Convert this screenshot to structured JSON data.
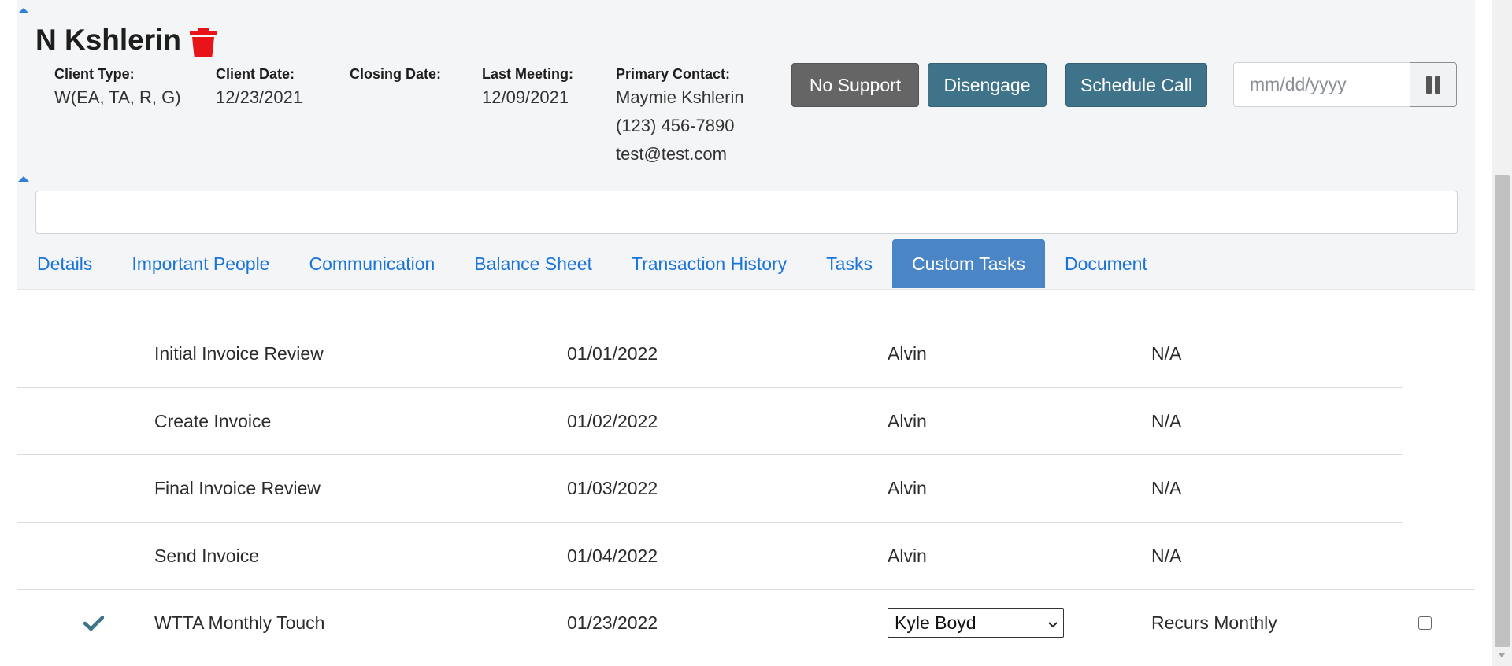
{
  "client": {
    "name": "N Kshlerin"
  },
  "fields": {
    "client_type": {
      "label": "Client Type:",
      "value": "W(EA, TA, R, G)"
    },
    "client_date": {
      "label": "Client Date:",
      "value": "12/23/2021"
    },
    "closing_date": {
      "label": "Closing Date:",
      "value": ""
    },
    "last_meeting": {
      "label": "Last Meeting:",
      "value": "12/09/2021"
    },
    "primary_contact": {
      "label": "Primary Contact:",
      "name": "Maymie Kshlerin",
      "phone": "(123) 456-7890",
      "email": "test@test.com"
    }
  },
  "actions": {
    "no_support": "No Support",
    "disengage": "Disengage",
    "schedule_call": "Schedule Call",
    "date_placeholder": "mm/dd/yyyy"
  },
  "tabs": [
    {
      "label": "Details",
      "active": false
    },
    {
      "label": "Important People",
      "active": false
    },
    {
      "label": "Communication",
      "active": false
    },
    {
      "label": "Balance Sheet",
      "active": false
    },
    {
      "label": "Transaction History",
      "active": false
    },
    {
      "label": "Tasks",
      "active": false
    },
    {
      "label": "Custom Tasks",
      "active": true
    },
    {
      "label": "Document",
      "active": false
    }
  ],
  "tasks": [
    {
      "name": "Initial Invoice Review",
      "date": "01/01/2022",
      "assignee": "Alvin",
      "recurrence": "N/A"
    },
    {
      "name": "Create Invoice",
      "date": "01/02/2022",
      "assignee": "Alvin",
      "recurrence": "N/A"
    },
    {
      "name": "Final Invoice Review",
      "date": "01/03/2022",
      "assignee": "Alvin",
      "recurrence": "N/A"
    },
    {
      "name": "Send Invoice",
      "date": "01/04/2022",
      "assignee": "Alvin",
      "recurrence": "N/A"
    },
    {
      "name": "WTTA Monthly Touch",
      "date": "01/23/2022",
      "assignee": "Kyle Boyd",
      "recurrence": "Recurs Monthly",
      "completed": true,
      "checkbox": false
    }
  ],
  "icons": {
    "trash": "trash-icon",
    "check": "check-icon",
    "pause": "pause-icon",
    "chevron": "chevron-down-icon"
  },
  "colors": {
    "trash": "#e8141a",
    "btn_gray": "#656565",
    "btn_teal": "#3f738a",
    "tab_active": "#4a86c6",
    "link": "#1a73d9",
    "check": "#3f738a"
  }
}
